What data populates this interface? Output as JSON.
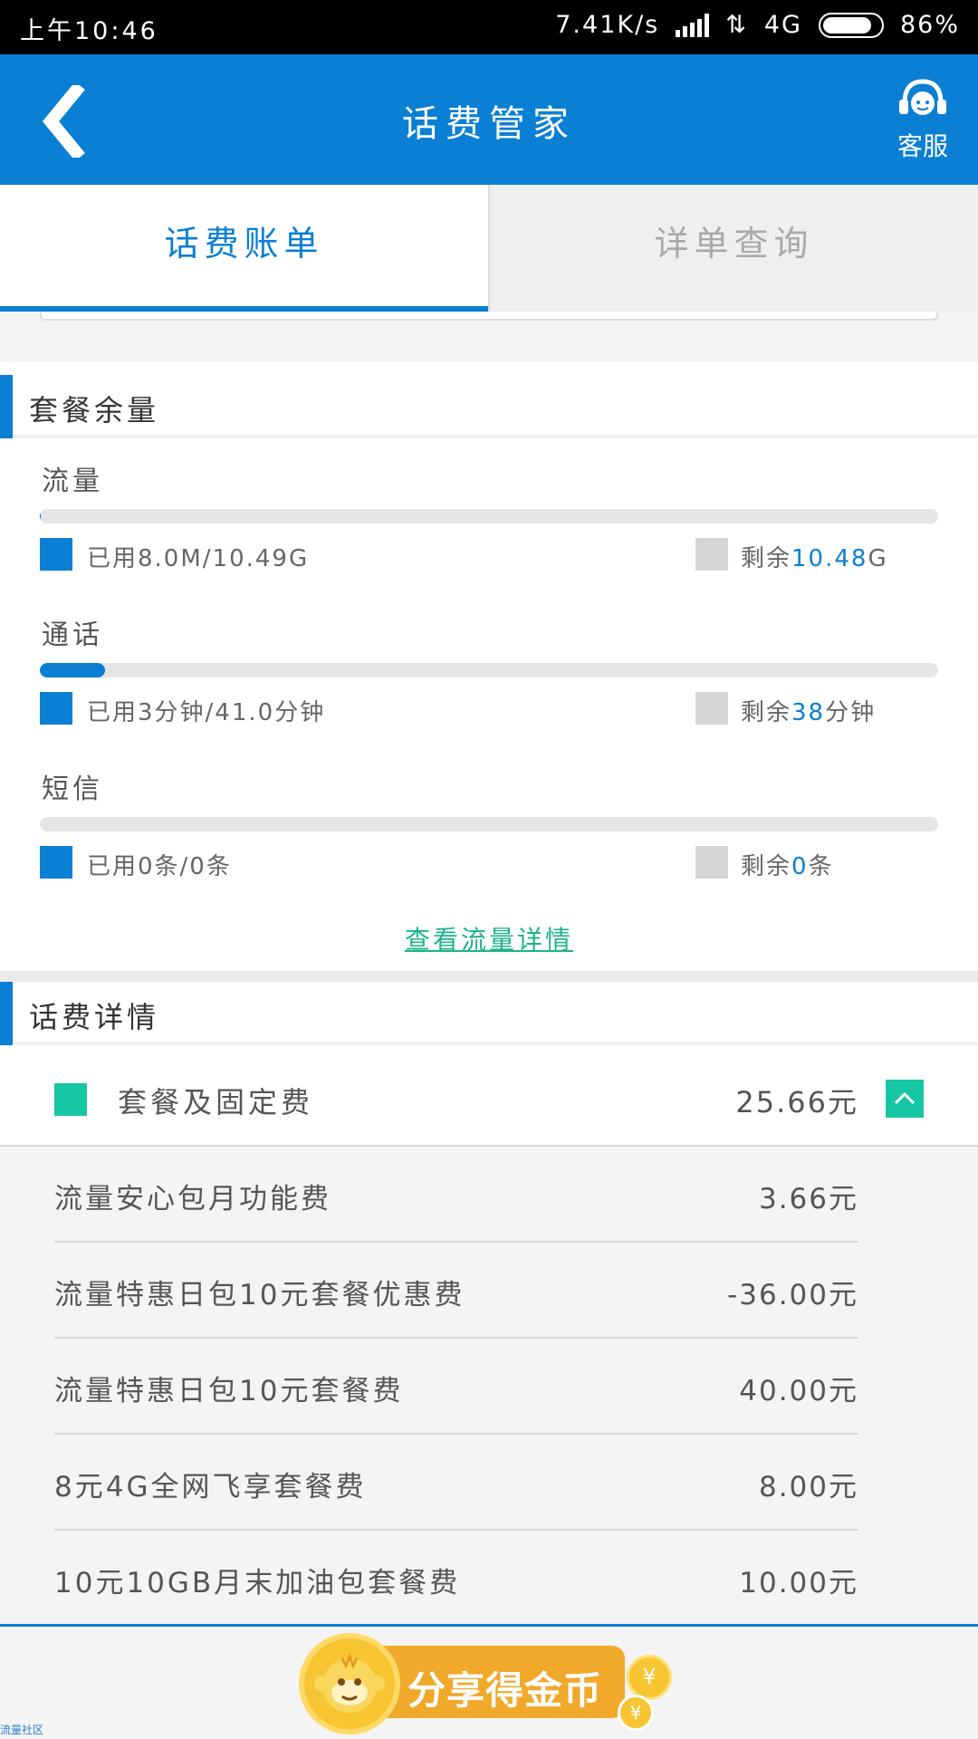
{
  "status_bar": {
    "time": "上午10:46",
    "speed": "7.41K/s",
    "network": "4G",
    "battery": "86%"
  },
  "header": {
    "title": "话费管家",
    "service_label": "客服"
  },
  "tabs": [
    {
      "label": "话费账单",
      "active": true
    },
    {
      "label": "详单查询",
      "active": false
    }
  ],
  "usage_section": {
    "title": "套餐余量",
    "items": [
      {
        "title": "流量",
        "used": "已用8.0M/10.49G",
        "remain_prefix": "剩余",
        "remain_value": "10.48",
        "remain_unit": "G",
        "used_fraction": 0.001
      },
      {
        "title": "通话",
        "used": "已用3分钟/41.0分钟",
        "remain_prefix": "剩余",
        "remain_value": "38",
        "remain_unit": "分钟",
        "used_fraction": 0.073
      },
      {
        "title": "短信",
        "used": "已用0条/0条",
        "remain_prefix": "剩余",
        "remain_value": "0",
        "remain_unit": "条",
        "used_fraction": 0
      }
    ],
    "view_link": "查看流量详情"
  },
  "fee_section": {
    "title": "话费详情",
    "main_item": {
      "name": "套餐及固定费",
      "amount": "25.66元"
    },
    "rows": [
      {
        "name": "流量安心包月功能费",
        "amount": "3.66元"
      },
      {
        "name": "流量特惠日包10元套餐优惠费",
        "amount": "-36.00元"
      },
      {
        "name": "流量特惠日包10元套餐费",
        "amount": "40.00元"
      },
      {
        "name": "8元4G全网飞享套餐费",
        "amount": "8.00元"
      },
      {
        "name": "10元10GB月末加油包套餐费",
        "amount": "10.00元"
      }
    ]
  },
  "share": {
    "label": "分享得金币",
    "coin_symbol": "¥"
  },
  "watermark": "流量社区",
  "colors": {
    "primary": "#0a7fd4",
    "accent_green": "#17c6a3",
    "link_green": "#1bb48a",
    "coin_orange": "#f0a92a"
  }
}
